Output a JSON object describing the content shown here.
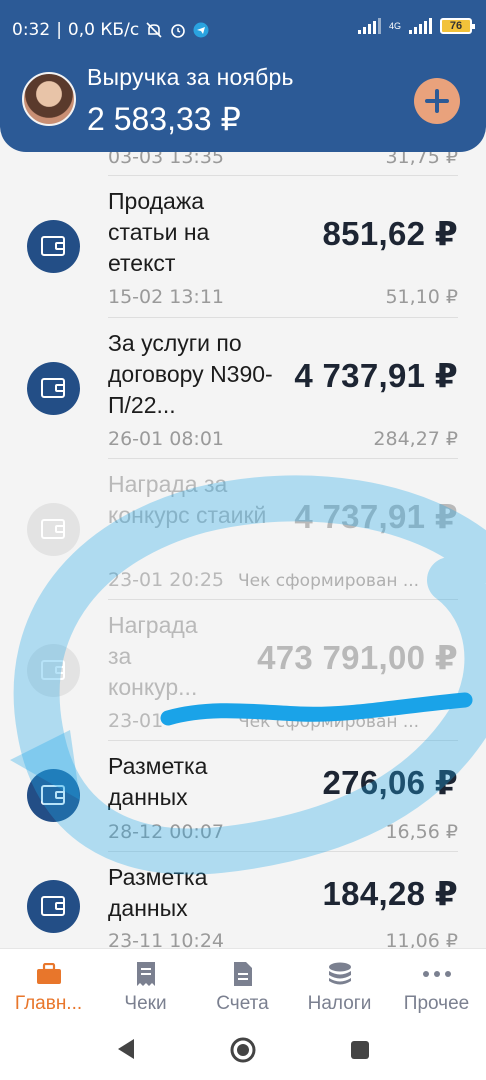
{
  "status_bar": {
    "time": "0:32",
    "speed": "0,0 КБ/с",
    "network": "4G",
    "battery": "76"
  },
  "header": {
    "title": "Выручка за ноябрь",
    "amount": "2 583,33 ₽"
  },
  "transactions": [
    {
      "title": "",
      "amount": "",
      "date": "03-03 13:35",
      "fee": "31,75 ₽",
      "faded": false
    },
    {
      "title": "Продажа статьи на етекст",
      "amount": "851,62 ₽",
      "date": "15-02 13:11",
      "fee": "51,10 ₽",
      "faded": false
    },
    {
      "title": "За услуги по договору N390- П/22...",
      "amount": "4 737,91 ₽",
      "date": "26-01 08:01",
      "fee": "284,27 ₽",
      "faded": false
    },
    {
      "title": "Награда за конкурс стаикй",
      "amount": "4 737,91 ₽",
      "date": "23-01 20:25",
      "fee": "Чек сформирован ...",
      "faded": true
    },
    {
      "title": "Награда за конкур...",
      "amount": "473 791,00 ₽",
      "date": "23-01",
      "fee": "Чек сформирован ...",
      "faded": true
    },
    {
      "title": "Разметка данных",
      "amount": "276,06 ₽",
      "date": "28-12 00:07",
      "fee": "16,56 ₽",
      "faded": false
    },
    {
      "title": "Разметка данных",
      "amount": "184,28 ₽",
      "date": "23-11 10:24",
      "fee": "11,06 ₽",
      "faded": false
    }
  ],
  "nav": {
    "items": [
      {
        "label": "Главн...",
        "icon": "briefcase-icon",
        "active": true
      },
      {
        "label": "Чеки",
        "icon": "receipt-icon",
        "active": false
      },
      {
        "label": "Счета",
        "icon": "document-icon",
        "active": false
      },
      {
        "label": "Налоги",
        "icon": "coins-icon",
        "active": false
      },
      {
        "label": "Прочее",
        "icon": "more-icon",
        "active": false
      }
    ]
  },
  "colors": {
    "header": "#2c5a96",
    "accent": "#e8762b",
    "wallet": "#234e86",
    "annotation": "#1fa7e8"
  }
}
